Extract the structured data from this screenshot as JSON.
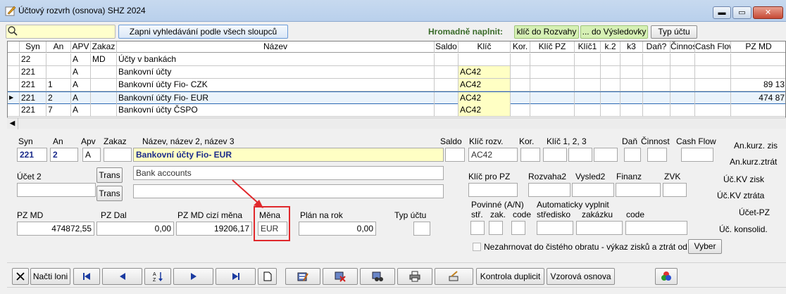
{
  "window": {
    "title": "Účtový rozvrh (osnova) SHZ 2024",
    "controls": {
      "minimize": "▬",
      "maximize": "▭",
      "close": "✕"
    }
  },
  "toolbar": {
    "search_value": "",
    "search_all_label": "Zapni vyhledávání podle všech sloupců",
    "bulk_fill_label": "Hromadně naplnit:",
    "fill_key_label": "klíč do Rozvahy",
    "fill_result_label": "... do Výsledovky",
    "account_type_label": "Typ účtu"
  },
  "grid": {
    "headers": [
      "Syn",
      "An",
      "APV",
      "Zakaz",
      "Název",
      "Saldo",
      "Klíč",
      "Kor.",
      "Klíč PZ",
      "Klíč1",
      "k.2",
      "k3",
      "Daň?",
      "Činnost",
      "Cash Flow",
      "PZ MD"
    ],
    "rows": [
      [
        "22",
        "",
        "A",
        "MD",
        "Účty v bankách",
        "",
        "",
        "",
        "",
        "",
        "",
        "",
        "",
        "",
        "",
        ""
      ],
      [
        "221",
        "",
        "A",
        "",
        "Bankovní účty",
        "",
        "AC42",
        "",
        "",
        "",
        "",
        "",
        "",
        "",
        "",
        ""
      ],
      [
        "221",
        "1",
        "A",
        "",
        "Bankovní účty Fio- CZK",
        "",
        "AC42",
        "",
        "",
        "",
        "",
        "",
        "",
        "",
        "",
        "89 13"
      ],
      [
        "221",
        "2",
        "A",
        "",
        "Bankovní účty Fio- EUR",
        "",
        "AC42",
        "",
        "",
        "",
        "",
        "",
        "",
        "",
        "",
        "474 87"
      ],
      [
        "221",
        "7",
        "A",
        "",
        "Bankovní účty ČSPO",
        "",
        "AC42",
        "",
        "",
        "",
        "",
        "",
        "",
        "",
        "",
        ""
      ]
    ],
    "selected_row_marker": "▶",
    "scroll_left": "◀"
  },
  "form": {
    "labels": {
      "syn": "Syn",
      "an": "An",
      "apv": "Apv",
      "zakaz": "Zakaz",
      "nazev": "Název, název 2, název 3",
      "saldo": "Saldo",
      "klic_rozv": "Klíč rozv.",
      "kor": "Kor.",
      "klic123": "Klíč  1,  2,  3",
      "dan": "Daň",
      "cinnost": "Činnost",
      "cash_flow": "Cash Flow",
      "an_kurz_zisk": "An.kurz. zis",
      "an_kurz_ztrata": "An.kurz.ztrát",
      "ucet2": "Účet 2",
      "trans": "Trans",
      "klic_pz": "Klíč pro PZ",
      "rozvaha2": "Rozvaha2",
      "vysled2": "Vysled2",
      "finanz": "Finanz",
      "zvk": "ZVK",
      "kv_zisk": "Úč.KV zisk",
      "kv_ztrata": "Úč.KV ztráta",
      "ucet_pz": "Účet-PZ",
      "konsolid": "Úč. konsolid.",
      "pz_md": "PZ MD",
      "pz_dal": "PZ Dal",
      "pz_md_cizi": "PZ MD cizí měna",
      "mena": "Měna",
      "plan": "Plán na rok",
      "typ_uctu": "Typ účtu",
      "povinne": "Povinné (A/N)",
      "str": "stř.",
      "zak": "zak.",
      "code": "code",
      "auto_fill": "Automaticky vyplnit",
      "stredisko": "středisko",
      "zakazku": "zakázku",
      "code2": "code",
      "exclude": "Nezahrnovat do čistého obratu - výkaz zisků a ztrát od",
      "vyber": "Vyber"
    },
    "values": {
      "syn": "221",
      "an": "2",
      "apv": "A",
      "zakaz": "",
      "nazev": "Bankovní účty Fio- EUR",
      "klic_rozv": "AC42",
      "nazev2": "Bank accounts",
      "nazev3": "",
      "pz_md": "474872,55",
      "pz_dal": "0,00",
      "pz_md_cizi": "19206,17",
      "mena": "EUR",
      "plan": "0,00"
    }
  },
  "bottom": {
    "nacti_loni": "Načti loni",
    "kontrola": "Kontrola duplicit",
    "vzorova": "Vzorová osnova"
  }
}
